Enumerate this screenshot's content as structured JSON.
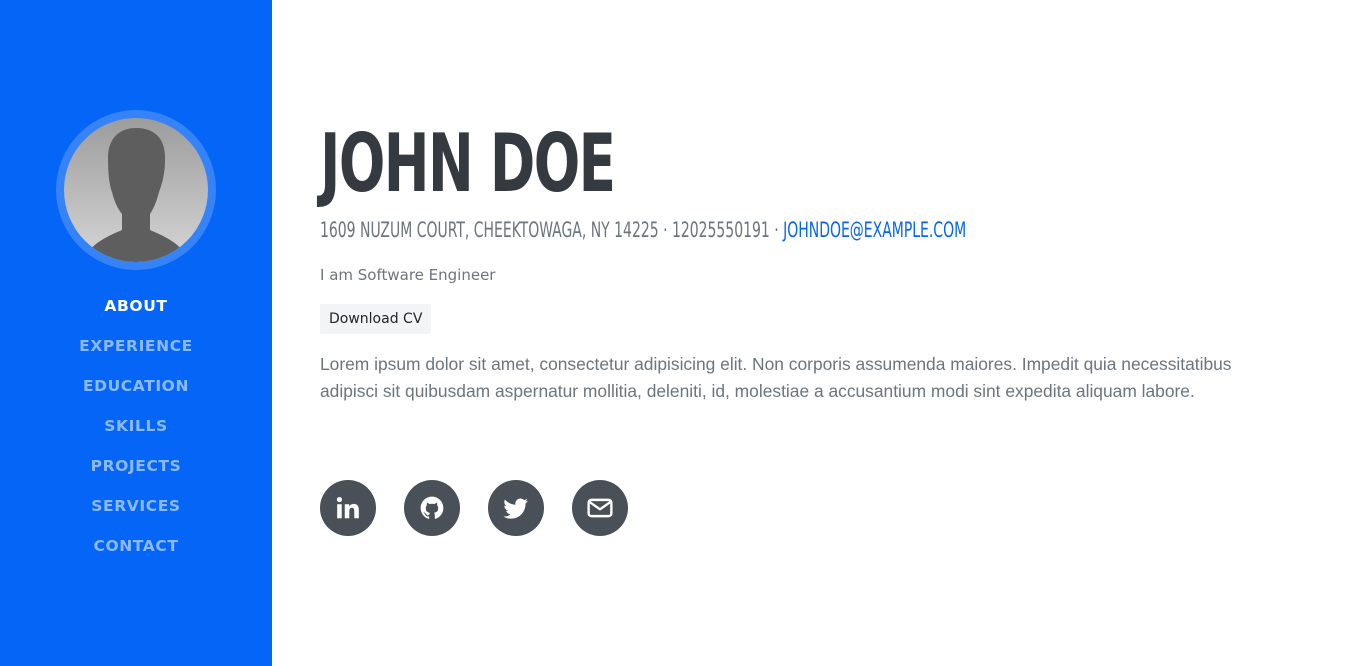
{
  "sidebar": {
    "nav": [
      {
        "label": "ABOUT",
        "active": true
      },
      {
        "label": "EXPERIENCE",
        "active": false
      },
      {
        "label": "EDUCATION",
        "active": false
      },
      {
        "label": "SKILLS",
        "active": false
      },
      {
        "label": "PROJECTS",
        "active": false
      },
      {
        "label": "SERVICES",
        "active": false
      },
      {
        "label": "CONTACT",
        "active": false
      }
    ],
    "background_color": "#0465f6"
  },
  "profile": {
    "name": "JOHN DOE",
    "address": "1609 NUZUM COURT, CHEEKTOWAGA, NY 14225",
    "separator": "·",
    "phone": "12025550191",
    "email": "JOHNDOE@EXAMPLE.COM",
    "subtitle": "I am Software Engineer",
    "download_label": "Download CV",
    "bio": "Lorem ipsum dolor sit amet, consectetur adipisicing elit. Non corporis assumenda maiores. Impedit quia necessitatibus adipisci sit quibusdam aspernatur mollitia, deleniti, id, molestiae a accusantium modi sint expedita aliquam labore."
  },
  "socials": [
    {
      "icon": "linkedin-icon"
    },
    {
      "icon": "github-icon"
    },
    {
      "icon": "twitter-icon"
    },
    {
      "icon": "envelope-icon"
    }
  ],
  "colors": {
    "accent": "#0465f6",
    "heading": "#343a40",
    "muted": "#6c757d",
    "social_bg": "#495057"
  }
}
